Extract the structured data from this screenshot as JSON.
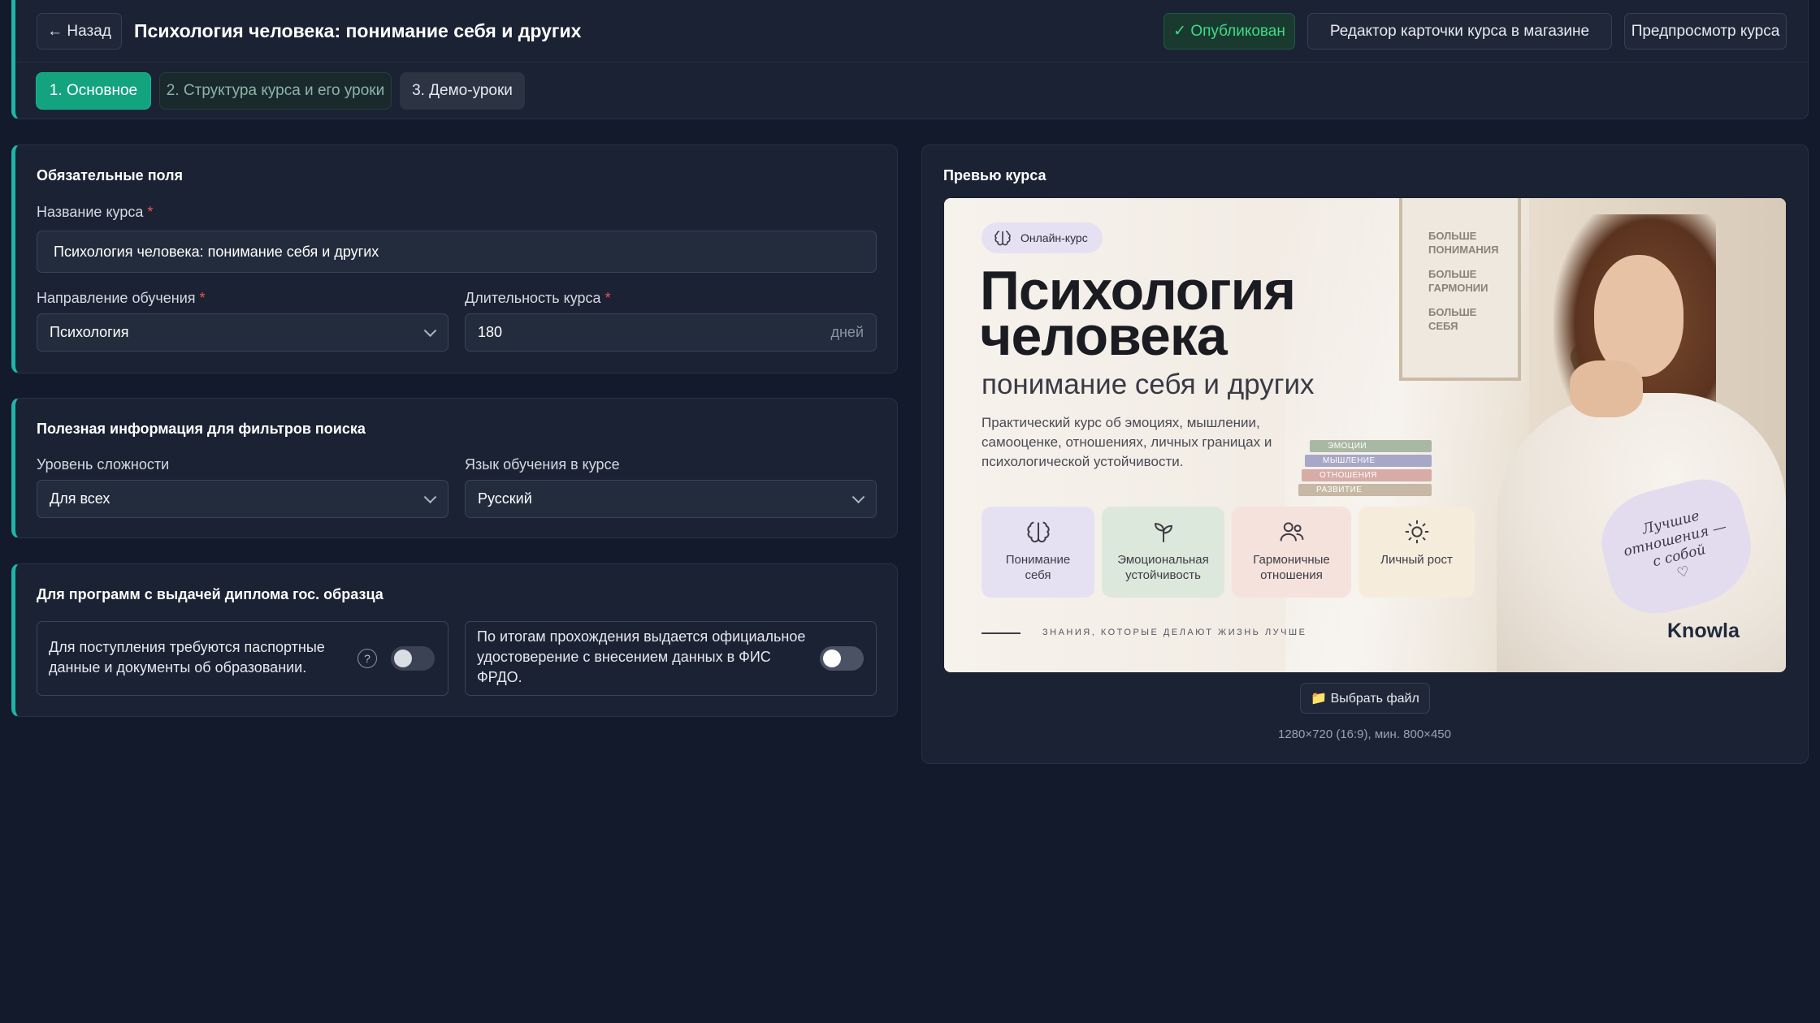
{
  "header": {
    "back_label": "← Назад",
    "title": "Психология человека: понимание себя и других",
    "status_badge": "✓ Опубликован",
    "store_editor_button": "Редактор карточки курса в магазине",
    "preview_button": "Предпросмотр курса"
  },
  "tabs": [
    {
      "label": "1. Основное",
      "state": "active"
    },
    {
      "label": "2. Структура курса и его уроки",
      "state": "inactive"
    },
    {
      "label": "3. Демо-уроки",
      "state": "inactive"
    }
  ],
  "required_section": {
    "title": "Обязательные поля",
    "course_name_label": "Название курса",
    "course_name_value": "Психология человека: понимание себя и других",
    "direction_label": "Направление обучения",
    "direction_value": "Психология",
    "duration_label": "Длительность курса",
    "duration_value": "180",
    "duration_unit": "дней",
    "required_mark": "*"
  },
  "filters_section": {
    "title": "Полезная информация для фильтров поиска",
    "level_label": "Уровень сложности",
    "level_value": "Для всех",
    "language_label": "Язык обучения в курсе",
    "language_value": "Русский"
  },
  "diploma_section": {
    "title": "Для программ с выдачей диплома гос. образца",
    "passport_text": "Для поступления требуются паспортные данные и документы об образовании.",
    "help_mark": "?",
    "certificate_text": "По итогам прохождения выдается официальное удостоверение с внесением данных в ФИС ФРДО.",
    "passport_toggle_on": false,
    "certificate_toggle_on": false
  },
  "preview_section": {
    "title": "Превью курса",
    "choose_file_label": "📁 Выбрать файл",
    "size_hint": "1280×720 (16:9), мин. 800×450"
  },
  "cover": {
    "badge": "Онлайн-курс",
    "title_line1": "Психология",
    "title_line2": "человека",
    "subtitle": "понимание себя и других",
    "description": "Практический курс об эмоциях, мышлении, самооценке, отношениях, личных границах и психологической устойчивости.",
    "poster_lines": [
      "БОЛЬШЕ ПОНИМАНИЯ",
      "БОЛЬШЕ ГАРМОНИИ",
      "БОЛЬШЕ СЕБЯ"
    ],
    "books": [
      "ЭМОЦИИ",
      "МЫШЛЕНИЕ",
      "ОТНОШЕНИЯ",
      "РАЗВИТИЕ"
    ],
    "tiles": [
      {
        "label": "Понимание себя",
        "icon": "brain-icon",
        "color": "#e6e1f2"
      },
      {
        "label": "Эмоциональная устойчивость",
        "icon": "sprout-icon",
        "color": "#dde8dc"
      },
      {
        "label": "Гармоничные отношения",
        "icon": "people-icon",
        "color": "#f5e2dc"
      },
      {
        "label": "Личный рост",
        "icon": "sun-icon",
        "color": "#f6ecdc"
      }
    ],
    "handwritten_note": "Лучшие отношения — с собой",
    "footer_tagline": "ЗНАНИЯ, КОТОРЫЕ ДЕЛАЮТ ЖИЗНЬ ЛУЧШЕ",
    "brand": "Knowla"
  },
  "colors": {
    "background": "#131a2b",
    "card": "#1a2233",
    "accent": "#1fb5a6",
    "active_tab": "#13a37f",
    "published": "#3ddc84"
  }
}
